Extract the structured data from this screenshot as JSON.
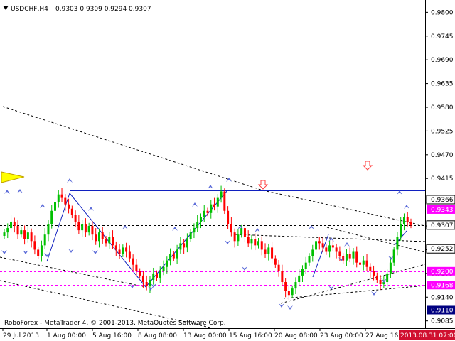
{
  "header": {
    "symbol": "USDCHF,H4",
    "ohlc": "0.9303 0.9309 0.9294 0.9307"
  },
  "footer_text": "RoboForex - MetaTrader 4, © 2001-2013, MetaQuotes Software Corp.",
  "colors": {
    "background": "#ffffff",
    "candle_up": "#00c000",
    "candle_down": "#ff0000",
    "fractal": "#5a6ad8",
    "level_line": "#1020c0",
    "dashed_line": "#000000",
    "magenta_line": "#ff00ff",
    "time_badge": "#d01030",
    "level_badge_magenta": "#ff00ff",
    "level_badge_blue": "#000080",
    "level_badge_white": "#ffffff",
    "arrow_down": "#ff4040",
    "triangle": "#ffff00"
  },
  "price_axis": {
    "ticks": [
      "0.9800",
      "0.9745",
      "0.9690",
      "0.9635",
      "0.9580",
      "0.9525",
      "0.9470",
      "0.9415",
      "0.9360",
      "0.9305",
      "0.9250",
      "0.9195",
      "0.9140",
      "0.9085"
    ]
  },
  "time_axis": {
    "ticks": [
      "29 Jul 2013",
      "1 Aug 00:00",
      "5 Aug 16:00",
      "8 Aug 08:00",
      "13 Aug 00:00",
      "15 Aug 16:00",
      "20 Aug 08:00",
      "23 Aug 00:00",
      "27 Aug 16:00"
    ],
    "current_time": "2013.08.31 07:00"
  },
  "level_badges": [
    {
      "text": "0.9366",
      "style": "white"
    },
    {
      "text": "0.9343",
      "style": "magenta"
    },
    {
      "text": "0.9307",
      "style": "white"
    },
    {
      "text": "0.9252",
      "style": "white"
    },
    {
      "text": "0.9200",
      "style": "magenta"
    },
    {
      "text": "0.9168",
      "style": "magenta"
    },
    {
      "text": "0.9110",
      "style": "blue"
    }
  ],
  "chart_data": {
    "type": "candlestick",
    "title": "USDCHF,H4",
    "ylim": [
      0.9068,
      0.9822
    ],
    "horizontal_levels": [
      {
        "price": 0.9387,
        "style": "solid-blue"
      },
      {
        "price": 0.9366,
        "style": "dashed-black"
      },
      {
        "price": 0.9343,
        "style": "magenta-dashed"
      },
      {
        "price": 0.9307,
        "style": "dashed-black"
      },
      {
        "price": 0.9252,
        "style": "dashed-black"
      },
      {
        "price": 0.92,
        "style": "magenta-dashed"
      },
      {
        "price": 0.9168,
        "style": "magenta-dashed"
      },
      {
        "price": 0.911,
        "style": "dashed-black"
      }
    ],
    "closes": [
      0.929,
      0.93,
      0.9315,
      0.9305,
      0.9285,
      0.9295,
      0.9275,
      0.929,
      0.927,
      0.925,
      0.9235,
      0.926,
      0.9285,
      0.931,
      0.934,
      0.936,
      0.9378,
      0.937,
      0.9355,
      0.9345,
      0.933,
      0.9315,
      0.9295,
      0.931,
      0.929,
      0.9305,
      0.9285,
      0.927,
      0.929,
      0.9275,
      0.9265,
      0.928,
      0.926,
      0.925,
      0.924,
      0.9255,
      0.9245,
      0.923,
      0.9215,
      0.92,
      0.919,
      0.9175,
      0.9165,
      0.918,
      0.9195,
      0.9185,
      0.92,
      0.921,
      0.9225,
      0.924,
      0.923,
      0.925,
      0.9265,
      0.9255,
      0.9275,
      0.929,
      0.93,
      0.9315,
      0.9325,
      0.934,
      0.9335,
      0.9355,
      0.935,
      0.937,
      0.9385,
      0.934,
      0.931,
      0.929,
      0.927,
      0.9285,
      0.93,
      0.928,
      0.9265,
      0.9275,
      0.926,
      0.927,
      0.925,
      0.924,
      0.9255,
      0.923,
      0.9215,
      0.92,
      0.9175,
      0.9155,
      0.9145,
      0.916,
      0.9175,
      0.919,
      0.9205,
      0.922,
      0.9235,
      0.925,
      0.927,
      0.9265,
      0.9255,
      0.9245,
      0.926,
      0.9255,
      0.9245,
      0.9235,
      0.9225,
      0.924,
      0.923,
      0.9245,
      0.922,
      0.9215,
      0.9225,
      0.921,
      0.92,
      0.919,
      0.918,
      0.917,
      0.9175,
      0.9195,
      0.922,
      0.925,
      0.928,
      0.931,
      0.9325,
      0.9315,
      0.9307
    ]
  }
}
